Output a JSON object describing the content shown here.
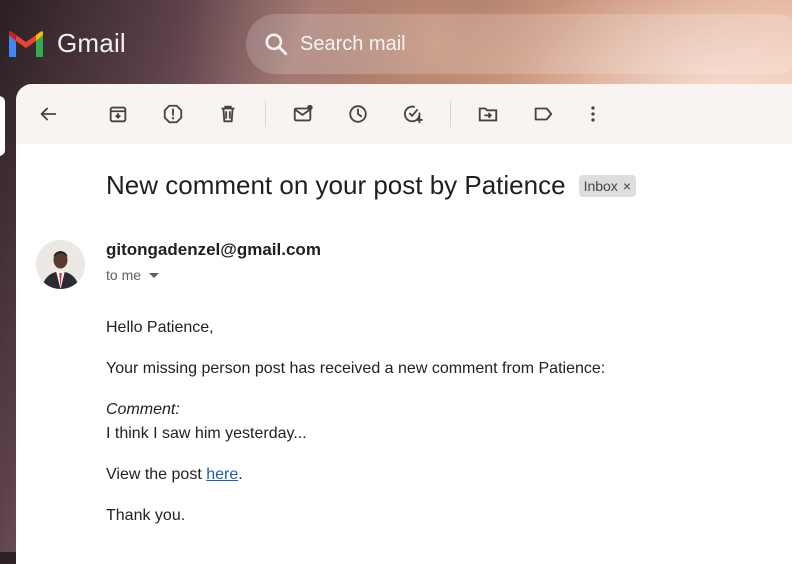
{
  "app": {
    "name": "Gmail"
  },
  "search": {
    "placeholder": "Search mail"
  },
  "toolbar": {
    "buttons": [
      "back-icon",
      "archive-icon",
      "report-spam-icon",
      "delete-icon",
      "mark-unread-icon",
      "snooze-icon",
      "add-task-icon",
      "move-to-icon",
      "label-icon",
      "more-options-icon"
    ]
  },
  "email": {
    "subject": "New comment on your post by Patience",
    "label": "Inbox",
    "label_close": "×",
    "sender": "gitongadenzel@gmail.com",
    "recipient": "to me",
    "greeting": "Hello Patience,",
    "intro": "Your missing person post has received a new comment from Patience:",
    "comment_label": "Comment:",
    "comment_text": "I think I saw him yesterday...",
    "view_prefix": "View the post ",
    "view_link": "here",
    "view_suffix": ".",
    "signoff": "Thank you."
  },
  "colors": {
    "link": "#1a5fb4",
    "badge_bg": "#dddddd"
  }
}
